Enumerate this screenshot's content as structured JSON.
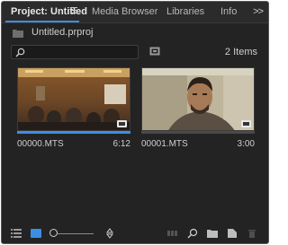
{
  "tabs": [
    {
      "label": "Project: Untitled",
      "active": true
    },
    {
      "label": "Media Browser",
      "active": false
    },
    {
      "label": "Libraries",
      "active": false
    },
    {
      "label": "Info",
      "active": false
    }
  ],
  "overflow_label": ">>",
  "project": {
    "name": "Untitled.prproj"
  },
  "search": {
    "value": "",
    "placeholder": ""
  },
  "item_count": "2 Items",
  "clips": [
    {
      "name": "00000.MTS",
      "duration": "6:12",
      "progress": 1.0
    },
    {
      "name": "00001.MTS",
      "duration": "3:00",
      "progress": 0.0
    }
  ],
  "zoom_level": 0.0,
  "colors": {
    "accent": "#3b8ee6",
    "panel": "#232323",
    "text": "#cfcfcf"
  },
  "bottom_icons": [
    "list-view-icon",
    "icon-view-icon",
    "zoom-slider",
    "sort-icon",
    "automate-to-sequence-icon",
    "find-icon",
    "new-bin-icon",
    "new-item-icon",
    "clear-icon"
  ]
}
